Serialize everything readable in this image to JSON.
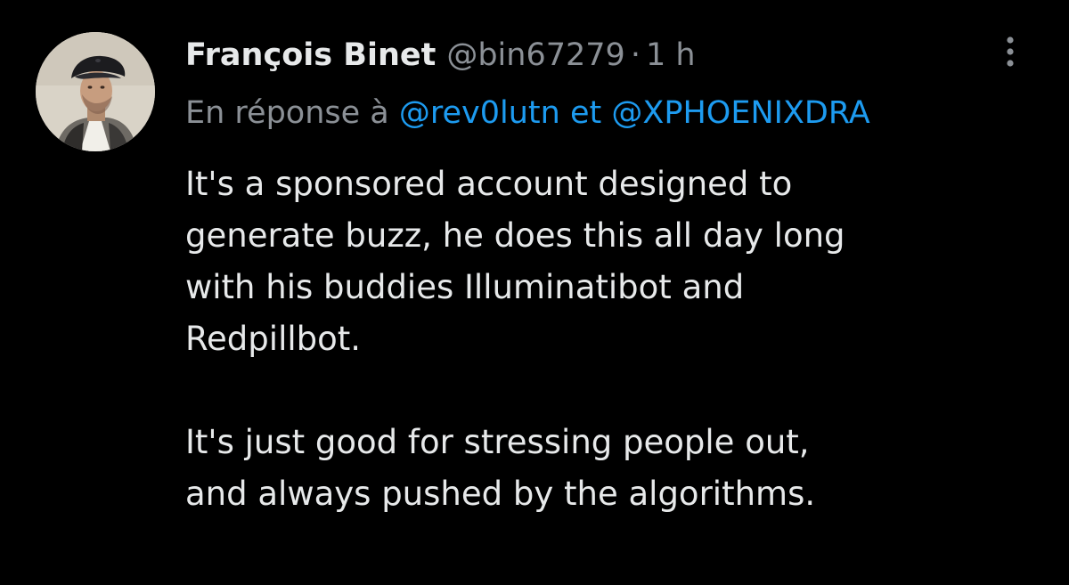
{
  "tweet": {
    "author": {
      "display_name": "François Binet",
      "handle": "@bin67279",
      "separator": "·",
      "time": "1 h"
    },
    "more_icon": "vertical-ellipsis-icon",
    "reply": {
      "prefix": "En réponse à",
      "mention_1": "@rev0lutn",
      "conjunction": "et",
      "mention_2": "@XPHOENIXDRA"
    },
    "body": {
      "paragraph_1": [
        "It's a sponsored account designed to",
        "generate buzz, he does this all day long",
        "with his buddies Illuminatibot and",
        "Redpillbot."
      ],
      "paragraph_2": [
        "It's just good for stressing people out,",
        "and always pushed by the algorithms."
      ]
    }
  },
  "colors": {
    "background": "#000000",
    "text_primary": "#e7e9ea",
    "text_secondary": "#8b9096",
    "link": "#1d9bf0"
  }
}
